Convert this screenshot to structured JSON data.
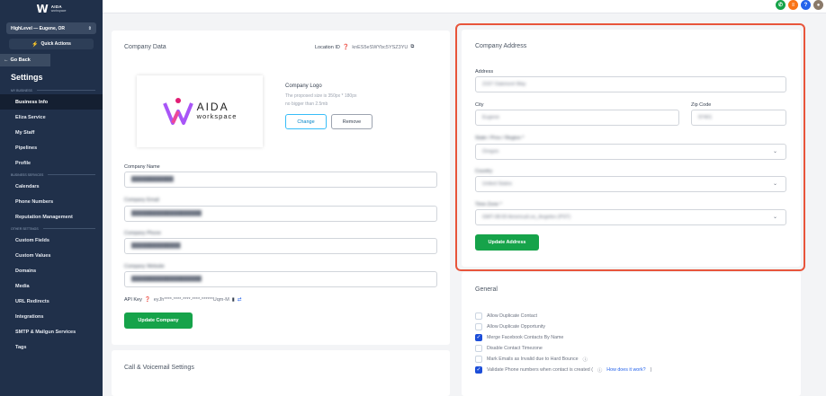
{
  "sidebar": {
    "logo_word": "AIDA",
    "logo_sub": "workspace",
    "location": "HighLevel — Eugene, OR",
    "quick_actions": "Quick Actions",
    "go_back": "Go Back",
    "settings_title": "Settings",
    "sections": {
      "my_business": "MY BUSINESS",
      "business_services": "BUSINESS SERVICES",
      "other_settings": "OTHER SETTINGS"
    },
    "items_my_business": [
      "Business Info",
      "Eliza Service",
      "My Staff",
      "Pipelines",
      "Profile"
    ],
    "items_business_services": [
      "Calendars",
      "Phone Numbers",
      "Reputation Management"
    ],
    "items_other_settings": [
      "Custom Fields",
      "Custom Values",
      "Domains",
      "Media",
      "URL Redirects",
      "Integrations",
      "SMTP & Mailgun Services",
      "Tags"
    ]
  },
  "company": {
    "title": "Company Data",
    "location_id_label": "Location ID",
    "location_id_value": "knES5eSWYbc5YSZ3YU",
    "logo_title": "Company Logo",
    "logo_hint_1": "The proposed size is 350px * 180px",
    "logo_hint_2": "no bigger than 2.5mb",
    "logo_word": "AIDA",
    "logo_sub": "workspace",
    "change": "Change",
    "remove": "Remove",
    "name_label": "Company Name",
    "email_label": "Company Email",
    "phone_label": "Company Phone",
    "website_label": "Company Website",
    "api_key_label": "API Key",
    "api_key_value": "eyJh****-****-****-****-******Uqm-M",
    "update_button": "Update Company"
  },
  "call_settings": {
    "title": "Call & Voicemail Settings"
  },
  "address": {
    "title": "Company Address",
    "address_label": "Address",
    "address_value": "2157 Oakmont Way",
    "city_label": "City",
    "city_value": "Eugene",
    "zip_label": "Zip Code",
    "zip_value": "97401",
    "state_label": "State / Prov / Region *",
    "state_value": "Oregon",
    "country_label": "Country",
    "country_value": "United States",
    "timezone_label": "Time Zone *",
    "timezone_value": "GMT-08:00 America/Los_Angeles (PST)",
    "update_button": "Update Address"
  },
  "general": {
    "title": "General",
    "options": [
      {
        "label": "Allow Duplicate Contact",
        "checked": false
      },
      {
        "label": "Allow Duplicate Opportunity",
        "checked": false
      },
      {
        "label": "Merge Facebook Contacts By Name",
        "checked": true
      },
      {
        "label": "Disable Contact Timezone",
        "checked": false
      },
      {
        "label": "Mark Emails as Invalid due to Hard Bounce",
        "checked": false
      },
      {
        "label": "Validate Phone numbers when contact is created (",
        "checked": true
      }
    ],
    "how_link": "How does it work?",
    "close_paren": ")"
  },
  "colors": {
    "sidebar_bg": "#20304a",
    "accent_green": "#16a34a",
    "highlight": "#e8553b",
    "checkbox_on": "#1d4ed8"
  },
  "icons": [
    "phone-icon",
    "megaphone-icon",
    "help-icon",
    "avatar"
  ]
}
